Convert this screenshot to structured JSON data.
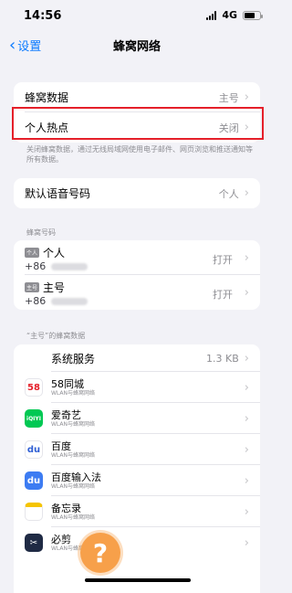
{
  "status": {
    "time": "14:56",
    "network": "4G"
  },
  "nav": {
    "back_label": "设置",
    "title": "蜂窝网络"
  },
  "top_rows": [
    {
      "label": "蜂窝数据",
      "value": "主号"
    },
    {
      "label": "个人热点",
      "value": "关闭"
    }
  ],
  "note": "关闭蜂窝数据，通过无线局域网使用电子邮件、网页浏览和推送通知等所有数据。",
  "voice_row": {
    "label": "默认语音号码",
    "value": "个人"
  },
  "numbers_header": "蜂窝号码",
  "numbers": [
    {
      "tag": "个人",
      "name": "个人",
      "phone": "+86",
      "value": "打开"
    },
    {
      "tag": "主号",
      "name": "主号",
      "phone": "+86",
      "value": "打开"
    }
  ],
  "data_header": "“主号”的蜂窝数据",
  "system_service": {
    "label": "系统服务",
    "value": "1.3 KB"
  },
  "apps": [
    {
      "name": "58同城",
      "sub": "WLAN与蜂窝网络",
      "icon": "58-app-icon",
      "glyph": "58",
      "color": "#ffffff",
      "fg": "#e5202a"
    },
    {
      "name": "爱奇艺",
      "sub": "WLAN与蜂窝网络",
      "icon": "iqiyi-app-icon",
      "glyph": "iQIYI",
      "color": "#00c853",
      "fg": "#ffffff"
    },
    {
      "name": "百度",
      "sub": "WLAN与蜂窝网络",
      "icon": "baidu-app-icon",
      "glyph": "du",
      "color": "#ffffff",
      "fg": "#2f5fd4"
    },
    {
      "name": "百度输入法",
      "sub": "WLAN与蜂窝网络",
      "icon": "baidu-ime-app-icon",
      "glyph": "du",
      "color": "#3d7cf2",
      "fg": "#ffffff"
    },
    {
      "name": "备忘录",
      "sub": "WLAN与蜂窝网络",
      "icon": "notes-app-icon",
      "glyph": "",
      "color": "#ffffff",
      "fg": "#f5c400"
    },
    {
      "name": "必剪",
      "sub": "WLAN与蜂窝网络",
      "icon": "bijian-app-icon",
      "glyph": "✂",
      "color": "#1f2a44",
      "fg": "#ffffff"
    }
  ],
  "help_glyph": "?"
}
